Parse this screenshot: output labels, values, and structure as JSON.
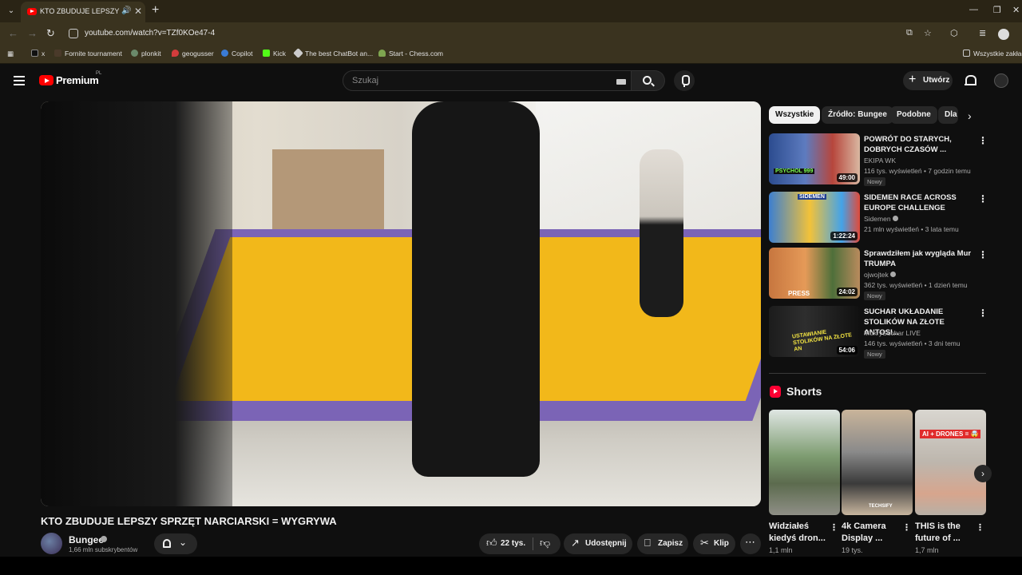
{
  "browser": {
    "tab_title": "KTO ZBUDUJE LEPSZY SPRZ",
    "url": "youtube.com/watch?v=TZf0KOe47-4",
    "bookmarks": [
      {
        "label": "x",
        "color": "#000000"
      },
      {
        "label": "Fornite tournament",
        "color": "#4a3a2a"
      },
      {
        "label": "plonkit",
        "color": "#6b8a6b"
      },
      {
        "label": "geogusser",
        "color": "#d23c3c"
      },
      {
        "label": "Copilot",
        "color": "#3a7bd5"
      },
      {
        "label": "Kick",
        "color": "#53fc18"
      },
      {
        "label": "The best ChatBot an...",
        "color": "#cccccc"
      },
      {
        "label": "Start - Chess.com",
        "color": "#7fa650"
      }
    ],
    "all_bookmarks_label": "Wszystkie zakład"
  },
  "header": {
    "logo_text": "Premium",
    "country": "PL",
    "search_placeholder": "Szukaj",
    "create_label": "Utwórz"
  },
  "video": {
    "title": "KTO ZBUDUJE LEPSZY SPRZĘT NARCIARSKI = WYGRYWA",
    "channel": "Bungee",
    "subscribers": "1,66 mln subskrybentów",
    "likes": "22 tys.",
    "share_label": "Udostępnij",
    "save_label": "Zapisz",
    "clip_label": "Klip"
  },
  "chips": [
    "Wszystkie",
    "Źródło: Bungee",
    "Podobne",
    "Dla"
  ],
  "recommendations": [
    {
      "title": "POWRÓT DO STARYCH, DOBRYCH CZASÓW ...",
      "channel": "EKIPA WK",
      "meta": "116 tys. wyświetleń • 7 godzin temu",
      "badge": "Nowy",
      "duration": "49:00"
    },
    {
      "title": "SIDEMEN RACE ACROSS EUROPE CHALLENGE",
      "channel": "Sidemen",
      "meta": "21 mln wyświetleń • 3 lata temu",
      "badge": "",
      "duration": "1:22:24"
    },
    {
      "title": "Sprawdziłem jak wygląda Mur TRUMPA",
      "channel": "ojwojtek",
      "meta": "362 tys. wyświetleń • 1 dzień temu",
      "badge": "Nowy",
      "duration": "24:02"
    },
    {
      "title": "SUCHAR UKŁADANIE STOLIKÓW NA ZŁOTE ANTOSI...",
      "channel": "MokrySuchar LIVE",
      "meta": "146 tys. wyświetleń • 3 dni temu",
      "badge": "Nowy",
      "duration": "54:06"
    }
  ],
  "shorts": {
    "heading": "Shorts",
    "items": [
      {
        "title": "Widziałeś kiedyś dron...",
        "views": "1,1 mln"
      },
      {
        "title": "4k Camera Display ...",
        "views": "19 tys."
      },
      {
        "title": "THIS is the future of ...",
        "views": "1,7 mln"
      }
    ]
  },
  "thumb_texts": {
    "rec1_tag": "PSYCHOL 999",
    "rec2_tag": "SIDEMEN",
    "rec3_tag": "PRESS",
    "rec4_tag": "USTAWIANIE STOLIKÓW NA ZŁOTE AN",
    "short2_tag": "TECHSIFY",
    "short3_tag": "AI + DRONES = 🤯"
  }
}
